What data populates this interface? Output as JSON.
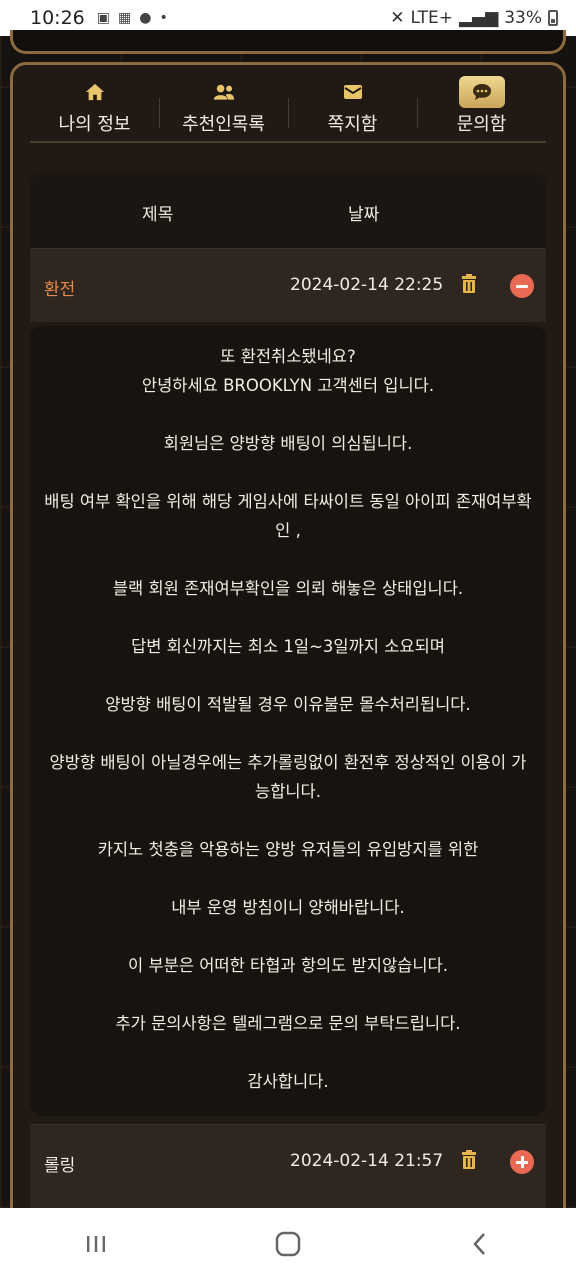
{
  "status_bar": {
    "time": "10:26",
    "battery": "33%",
    "network": "LTE+"
  },
  "tabs": [
    {
      "label": "나의 정보",
      "icon": "home-icon",
      "active": false
    },
    {
      "label": "추천인목록",
      "icon": "users-icon",
      "active": false
    },
    {
      "label": "쪽지함",
      "icon": "envelope-icon",
      "active": false
    },
    {
      "label": "문의함",
      "icon": "chat-icon",
      "active": true
    }
  ],
  "table": {
    "headers": {
      "title": "제목",
      "date": "날짜"
    },
    "rows": [
      {
        "title": "환전",
        "date": "2024-02-14 22:25",
        "expanded": true
      },
      {
        "title": "롤링",
        "date": "2024-02-14 21:57",
        "expanded": false
      }
    ]
  },
  "answer": {
    "lines": [
      "또 환전취소됐네요?",
      "안녕하세요 BROOKLYN 고객센터 입니다.",
      "회원님은 양방향 배팅이 의심됩니다.",
      "배팅 여부 확인을 위해 해당 게임사에 타싸이트 동일 아이피 존재여부확인 ,",
      "블랙 회원 존재여부확인을 의뢰 해놓은 상태입니다.",
      "답변 회신까지는 최소 1일~3일까지 소요되며",
      "양방향 배팅이 적발될 경우 이유불문 몰수처리됩니다.",
      "양방향 배팅이 아닐경우에는 추가롤링없이 환전후 정상적인 이용이 가능합니다.",
      "카지노 첫충을 악용하는 양방 유저들의 유입방지를 위한",
      "내부 운영 방침이니 양해바랍니다.",
      "이 부분은 어떠한 타협과 항의도 받지않습니다.",
      "추가 문의사항은 텔레그램으로 문의 부탁드립니다.",
      "감사합니다."
    ]
  },
  "colors": {
    "accent_gold": "#e5b64a",
    "accent_orange": "#e38a4a",
    "toggle_red": "#e86a55"
  }
}
